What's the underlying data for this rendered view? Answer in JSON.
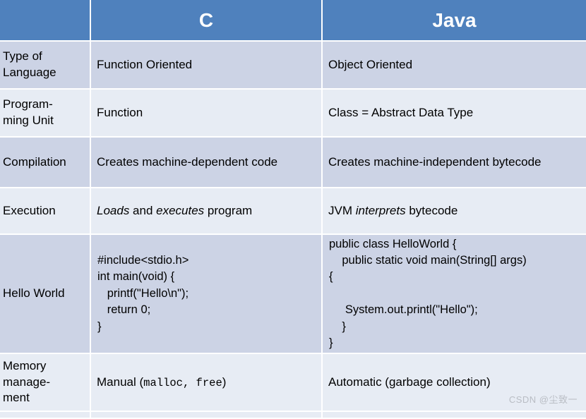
{
  "table": {
    "header": {
      "corner_label": "",
      "columns": [
        "C",
        "Java"
      ]
    },
    "rows": [
      {
        "id": "type-of-language",
        "label": "Type of Language",
        "c": "Function Oriented",
        "java": "Object Oriented"
      },
      {
        "id": "programming-unit",
        "label": "Program-\nming Unit",
        "c": "Function",
        "java": "Class = Abstract Data Type"
      },
      {
        "id": "compilation",
        "label": "Compilation",
        "c": "Creates machine-dependent code",
        "java": "Creates machine-independent bytecode"
      },
      {
        "id": "execution",
        "label": "Execution",
        "c_parts": [
          {
            "text": "Loads",
            "italic": true
          },
          {
            "text": " and ",
            "italic": false
          },
          {
            "text": "executes",
            "italic": true
          },
          {
            "text": " program",
            "italic": false
          }
        ],
        "java_parts": [
          {
            "text": "JVM ",
            "italic": false
          },
          {
            "text": "interprets",
            "italic": true
          },
          {
            "text": " bytecode",
            "italic": false
          }
        ]
      },
      {
        "id": "hello-world",
        "label": "Hello World",
        "c_code": "#include<stdio.h>\nint main(void) {\n   printf(\"Hello\\n\");\n   return 0;\n}",
        "java_code": "public class HelloWorld {\n    public static void main(String[] args)\n{\n\n     System.out.printl(\"Hello\");\n    }\n}"
      },
      {
        "id": "memory-management",
        "label": "Memory manage-\nment",
        "c_parts": [
          {
            "text": "Manual (",
            "mono": false
          },
          {
            "text": "malloc, free",
            "mono": true
          },
          {
            "text": ")",
            "mono": false
          }
        ],
        "java": "Automatic (garbage collection)"
      }
    ]
  },
  "watermark": {
    "text": "CSDN @尘致一"
  },
  "colors": {
    "header_blue": "#4F81BD",
    "band_dark": "#CCD3E5",
    "band_light": "#E7ECF4",
    "grid_white": "#FFFFFF",
    "text": "#000000",
    "watermark": "#B9BDC4"
  }
}
